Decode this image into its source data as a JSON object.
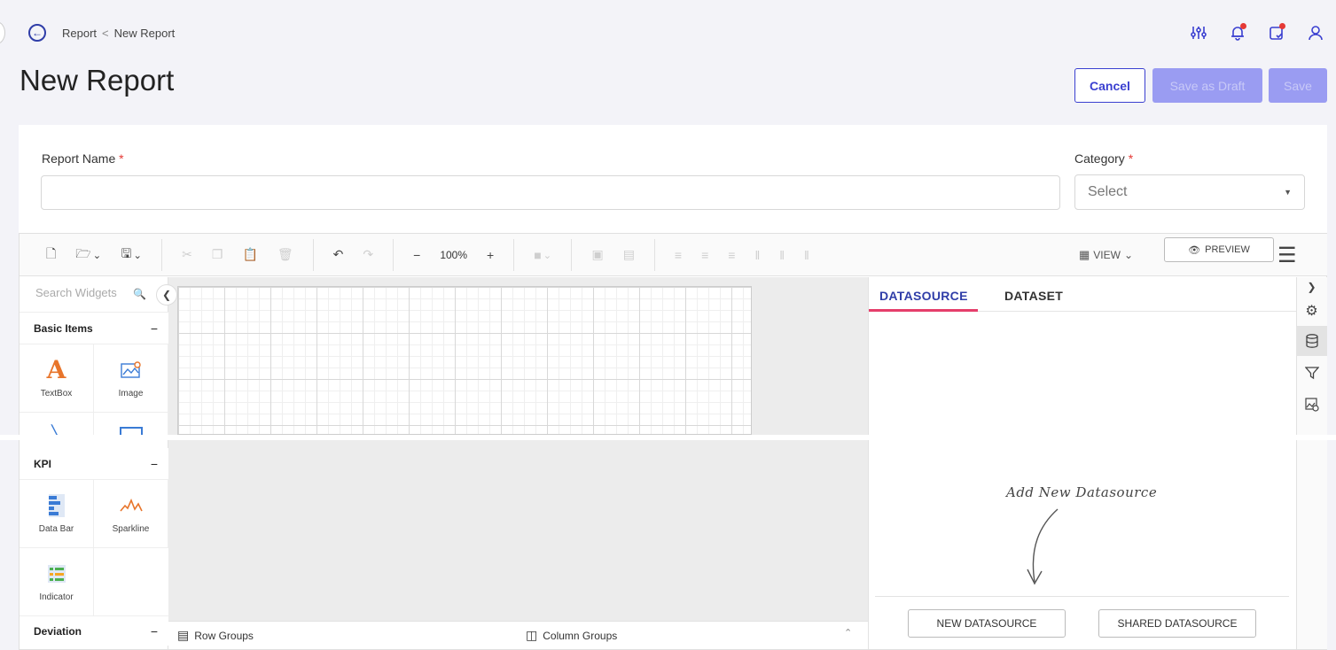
{
  "breadcrumb": {
    "parent": "Report",
    "separator": "<",
    "current": "New Report"
  },
  "page_title": "New Report",
  "header_icons": [
    "settings-sliders-icon",
    "notification-bell-icon",
    "calendar-check-icon",
    "user-icon"
  ],
  "actions": {
    "cancel": "Cancel",
    "save_draft": "Save as Draft",
    "save": "Save"
  },
  "form": {
    "report_name_label": "Report Name",
    "required_mark": "*",
    "report_name_value": "",
    "category_label": "Category",
    "category_value": "Select"
  },
  "toolbar": {
    "zoom": "100%",
    "zoom_out": "−",
    "zoom_in": "+",
    "view_label": "VIEW",
    "preview_label": "PREVIEW"
  },
  "widgets": {
    "search_placeholder": "Search Widgets",
    "sections": [
      {
        "title": "Basic Items",
        "items": [
          {
            "label": "TextBox",
            "icon": "textbox-icon"
          },
          {
            "label": "Image",
            "icon": "image-icon"
          }
        ]
      },
      {
        "title": "KPI",
        "items": [
          {
            "label": "Data Bar",
            "icon": "databar-icon"
          },
          {
            "label": "Sparkline",
            "icon": "sparkline-icon"
          },
          {
            "label": "Indicator",
            "icon": "indicator-icon"
          }
        ]
      },
      {
        "title": "Deviation",
        "items": []
      }
    ],
    "collapse_symbol": "−"
  },
  "grouping": {
    "row_groups": "Row Groups",
    "column_groups": "Column Groups"
  },
  "right_panel": {
    "tabs": [
      "DATASOURCE",
      "DATASET"
    ],
    "active_tab": "DATASOURCE",
    "empty_hint": "Add New Datasource",
    "new_datasource": "NEW DATASOURCE",
    "shared_datasource": "SHARED DATASOURCE"
  },
  "colors": {
    "accent": "#3a3fd0",
    "disabled_button": "#9a9cf2",
    "active_tab_underline": "#e53e6b",
    "required": "#e53935"
  }
}
